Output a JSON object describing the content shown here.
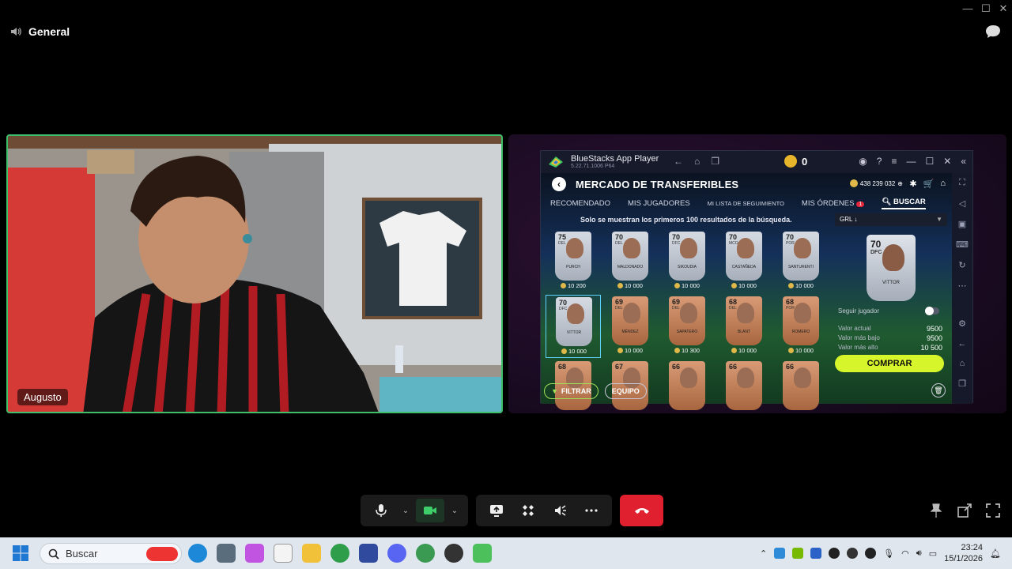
{
  "window": {
    "minimize": "—",
    "maximize": "☐",
    "close": "✕"
  },
  "channel": {
    "name": "General"
  },
  "participant": {
    "name": "Augusto"
  },
  "bluestacks": {
    "app_name": "BlueStacks App Player",
    "version": "5.22.71.1006  P64",
    "coin_count": "0"
  },
  "game": {
    "title": "MERCADO DE TRANSFERIBLES",
    "coins": "438 239 032",
    "tabs": [
      {
        "label": "RECOMENDADO"
      },
      {
        "label": "MIS JUGADORES"
      },
      {
        "label": "MI LISTA DE SEGUIMIENTO"
      },
      {
        "label": "MIS ÓRDENES",
        "badge": "1"
      },
      {
        "label": "BUSCAR"
      }
    ],
    "notice": "Solo se muestran los primeros 100 resultados de la búsqueda.",
    "sort_label": "GRL ↓",
    "cards": [
      {
        "rating": "75",
        "pos": "DEL",
        "name": "PURCH",
        "price": "10 200",
        "tier": "silver"
      },
      {
        "rating": "70",
        "pos": "DEL",
        "name": "MALDONADO",
        "price": "10 000",
        "tier": "silver"
      },
      {
        "rating": "70",
        "pos": "DFC",
        "name": "SIKOUDIA",
        "price": "10 000",
        "tier": "silver"
      },
      {
        "rating": "70",
        "pos": "MCO",
        "name": "CASTAÑEDA",
        "price": "10 000",
        "tier": "silver"
      },
      {
        "rating": "70",
        "pos": "POR",
        "name": "SANTURENTI",
        "price": "10 000",
        "tier": "silver"
      },
      {
        "rating": "70",
        "pos": "DFC",
        "name": "VITTOR",
        "price": "10 000",
        "tier": "silver",
        "selected": true
      },
      {
        "rating": "69",
        "pos": "DEL",
        "name": "MÉNDEZ",
        "price": "10 000",
        "tier": "bronze"
      },
      {
        "rating": "69",
        "pos": "DEL",
        "name": "SAPATERO",
        "price": "10 300",
        "tier": "bronze"
      },
      {
        "rating": "68",
        "pos": "DEL",
        "name": "BLANT",
        "price": "10 000",
        "tier": "bronze"
      },
      {
        "rating": "68",
        "pos": "POR",
        "name": "ROMERO",
        "price": "10 000",
        "tier": "bronze"
      },
      {
        "rating": "68",
        "pos": "",
        "name": "",
        "price": "",
        "tier": "bronze"
      },
      {
        "rating": "67",
        "pos": "",
        "name": "",
        "price": "",
        "tier": "bronze"
      },
      {
        "rating": "66",
        "pos": "",
        "name": "",
        "price": "",
        "tier": "bronze"
      },
      {
        "rating": "66",
        "pos": "",
        "name": "",
        "price": "",
        "tier": "bronze"
      },
      {
        "rating": "66",
        "pos": "",
        "name": "",
        "price": "",
        "tier": "bronze"
      }
    ],
    "selected": {
      "rating": "70",
      "pos": "DFC",
      "name": "VITTOR",
      "follow_label": "Seguir jugador",
      "current_label": "Valor actual",
      "current_value": "9500",
      "low_label": "Valor más bajo",
      "low_value": "9500",
      "high_label": "Valor más alto",
      "high_value": "10 500",
      "buy_label": "COMPRAR"
    },
    "filter_label": "FILTRAR",
    "team_label": "EQUIPO"
  },
  "taskbar": {
    "search_placeholder": "Buscar",
    "time": "23:24",
    "date": "15/1/2026"
  }
}
